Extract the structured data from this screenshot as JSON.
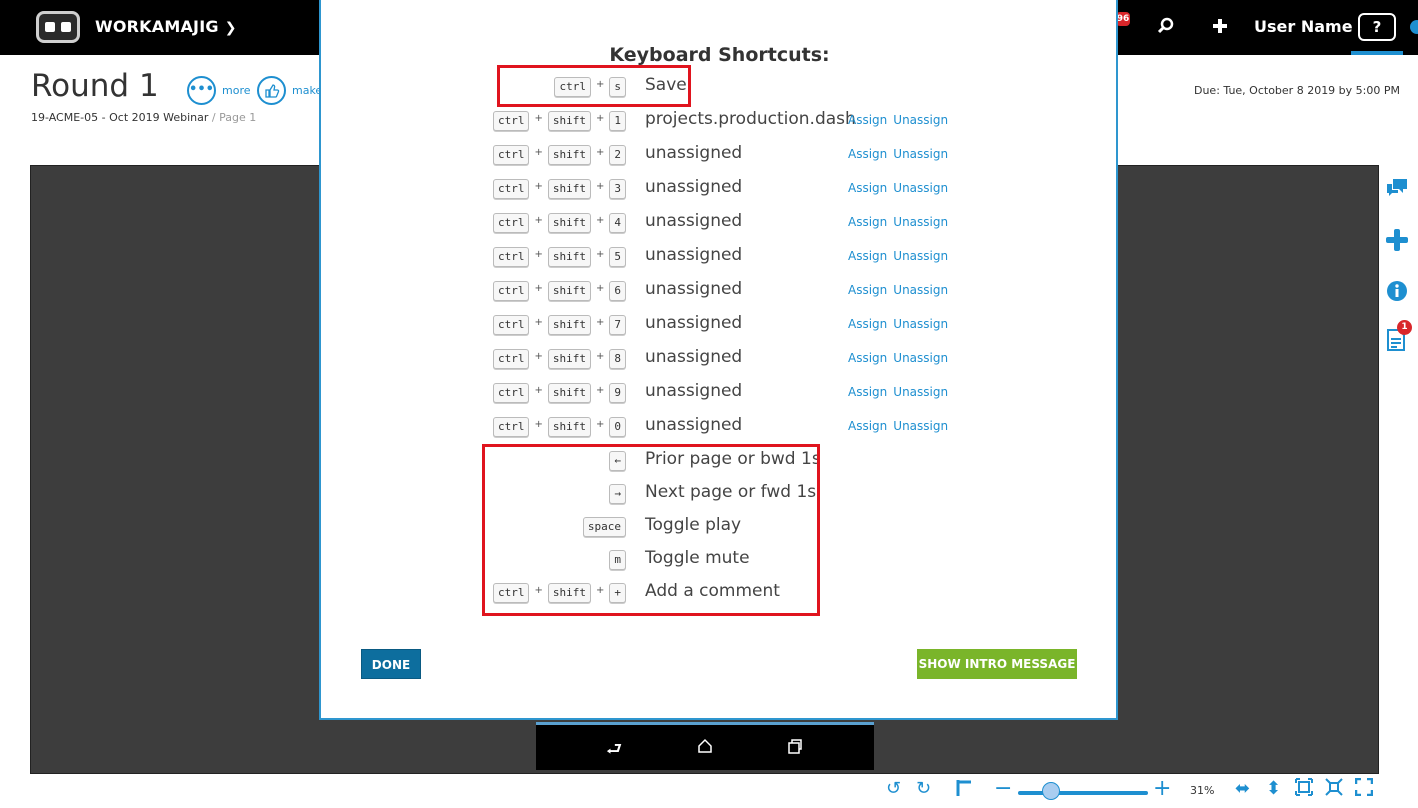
{
  "topbar": {
    "brand": "WORKAMAJIG",
    "notification_count": "96",
    "user_name": "User Name",
    "help_label": "?"
  },
  "header": {
    "title": "Round 1",
    "more_label": "more",
    "make_label": "make",
    "subtitle": "19-ACME-05 - Oct 2019 Webinar",
    "page": "/ Page 1",
    "due": "Due: Tue, October 8 2019 by 5:00 PM"
  },
  "right_rail": {
    "badge_count": "1"
  },
  "bottombar": {
    "zoom": "31%"
  },
  "modal": {
    "title": "Keyboard Shortcuts:",
    "shortcuts": [
      {
        "keys": [
          "ctrl",
          "s"
        ],
        "label": "Save"
      },
      {
        "keys": [
          "ctrl",
          "shift",
          "1"
        ],
        "label": "projects.production.dash",
        "assign": "Assign",
        "unassign": "Unassign"
      },
      {
        "keys": [
          "ctrl",
          "shift",
          "2"
        ],
        "label": "unassigned",
        "assign": "Assign",
        "unassign": "Unassign"
      },
      {
        "keys": [
          "ctrl",
          "shift",
          "3"
        ],
        "label": "unassigned",
        "assign": "Assign",
        "unassign": "Unassign"
      },
      {
        "keys": [
          "ctrl",
          "shift",
          "4"
        ],
        "label": "unassigned",
        "assign": "Assign",
        "unassign": "Unassign"
      },
      {
        "keys": [
          "ctrl",
          "shift",
          "5"
        ],
        "label": "unassigned",
        "assign": "Assign",
        "unassign": "Unassign"
      },
      {
        "keys": [
          "ctrl",
          "shift",
          "6"
        ],
        "label": "unassigned",
        "assign": "Assign",
        "unassign": "Unassign"
      },
      {
        "keys": [
          "ctrl",
          "shift",
          "7"
        ],
        "label": "unassigned",
        "assign": "Assign",
        "unassign": "Unassign"
      },
      {
        "keys": [
          "ctrl",
          "shift",
          "8"
        ],
        "label": "unassigned",
        "assign": "Assign",
        "unassign": "Unassign"
      },
      {
        "keys": [
          "ctrl",
          "shift",
          "9"
        ],
        "label": "unassigned",
        "assign": "Assign",
        "unassign": "Unassign"
      },
      {
        "keys": [
          "ctrl",
          "shift",
          "0"
        ],
        "label": "unassigned",
        "assign": "Assign",
        "unassign": "Unassign"
      },
      {
        "keys": [
          "←"
        ],
        "label": "Prior page or bwd 1s"
      },
      {
        "keys": [
          "→"
        ],
        "label": "Next page or fwd 1s"
      },
      {
        "keys": [
          "space"
        ],
        "label": "Toggle play"
      },
      {
        "keys": [
          "m"
        ],
        "label": "Toggle mute"
      },
      {
        "keys": [
          "ctrl",
          "shift",
          "+"
        ],
        "label": "Add a comment"
      }
    ],
    "done_label": "DONE",
    "intro_label": "SHOW INTRO MESSAGE"
  },
  "colors": {
    "accent": "#1e8fd0",
    "done_button": "#0d6e9e",
    "intro_button": "#7ab52a",
    "highlight": "#e0141e"
  }
}
